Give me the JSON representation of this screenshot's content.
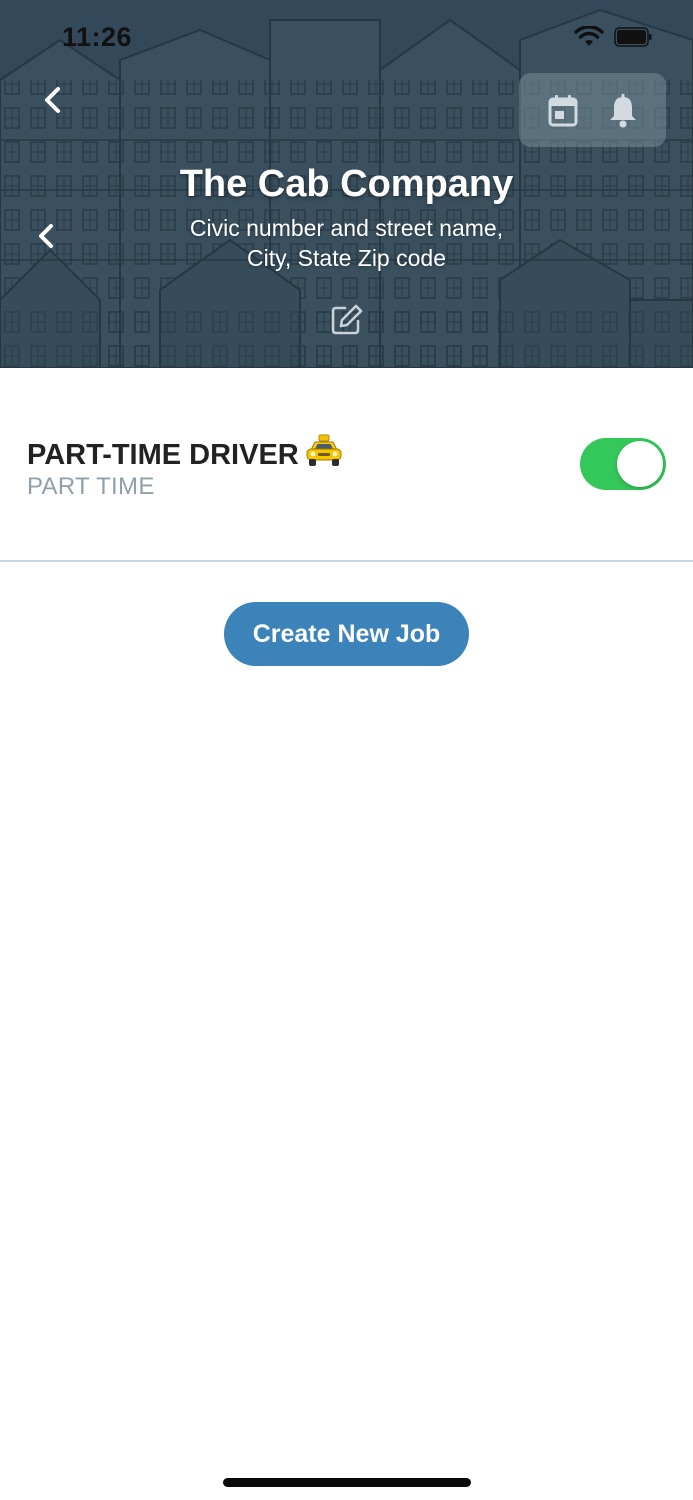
{
  "status_bar": {
    "time": "11:26",
    "wifi_icon": "wifi-icon",
    "battery_icon": "battery-icon"
  },
  "header": {
    "company_name": "The Cab Company",
    "address_line1": "Civic number and street name,",
    "address_line2": "City, State Zip code",
    "icons": [
      "back-icon",
      "calendar-icon",
      "bell-icon",
      "edit-icon"
    ]
  },
  "job": {
    "title": "PART-TIME DRIVER",
    "emoji_icon": "taxi-icon",
    "type": "PART TIME",
    "active": true
  },
  "actions": {
    "create_label": "Create New Job"
  },
  "colors": {
    "header_bg": "#3d5566",
    "toggle_on": "#34c759",
    "primary_button": "#3b83b8",
    "subtitle_gray": "#8fa0ab",
    "divider": "#c9d6df"
  }
}
